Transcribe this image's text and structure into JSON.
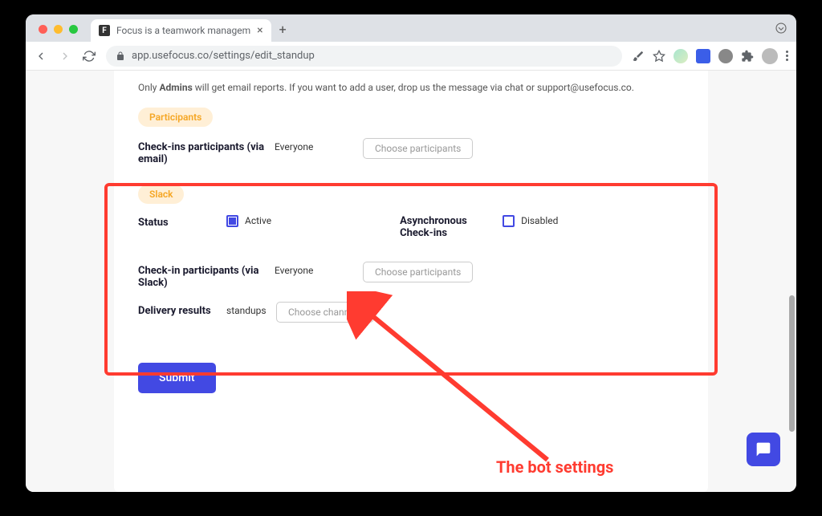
{
  "tab": {
    "favicon_letter": "F",
    "title": "Focus is a teamwork managem"
  },
  "url": "app.usefocus.co/settings/edit_standup",
  "notice": {
    "prefix": "Only ",
    "bold": "Admins",
    "rest": " will get email reports. If you want to add a user, drop us the message via chat or support@usefocus.co."
  },
  "sections": {
    "participants": {
      "pill": "Participants",
      "row_label": "Check-ins participants (via email)",
      "row_value": "Everyone",
      "choose_btn": "Choose participants"
    },
    "slack": {
      "pill": "Slack",
      "status_label": "Status",
      "status_value": "Active",
      "async_label": "Asynchronous Check-ins",
      "async_value": "Disabled",
      "checkin_label": "Check-in participants (via Slack)",
      "checkin_value": "Everyone",
      "checkin_btn": "Choose participants",
      "delivery_label": "Delivery results",
      "delivery_value": "standups",
      "delivery_btn": "Choose channels"
    }
  },
  "submit": "Submit",
  "annotation": "The bot settings"
}
